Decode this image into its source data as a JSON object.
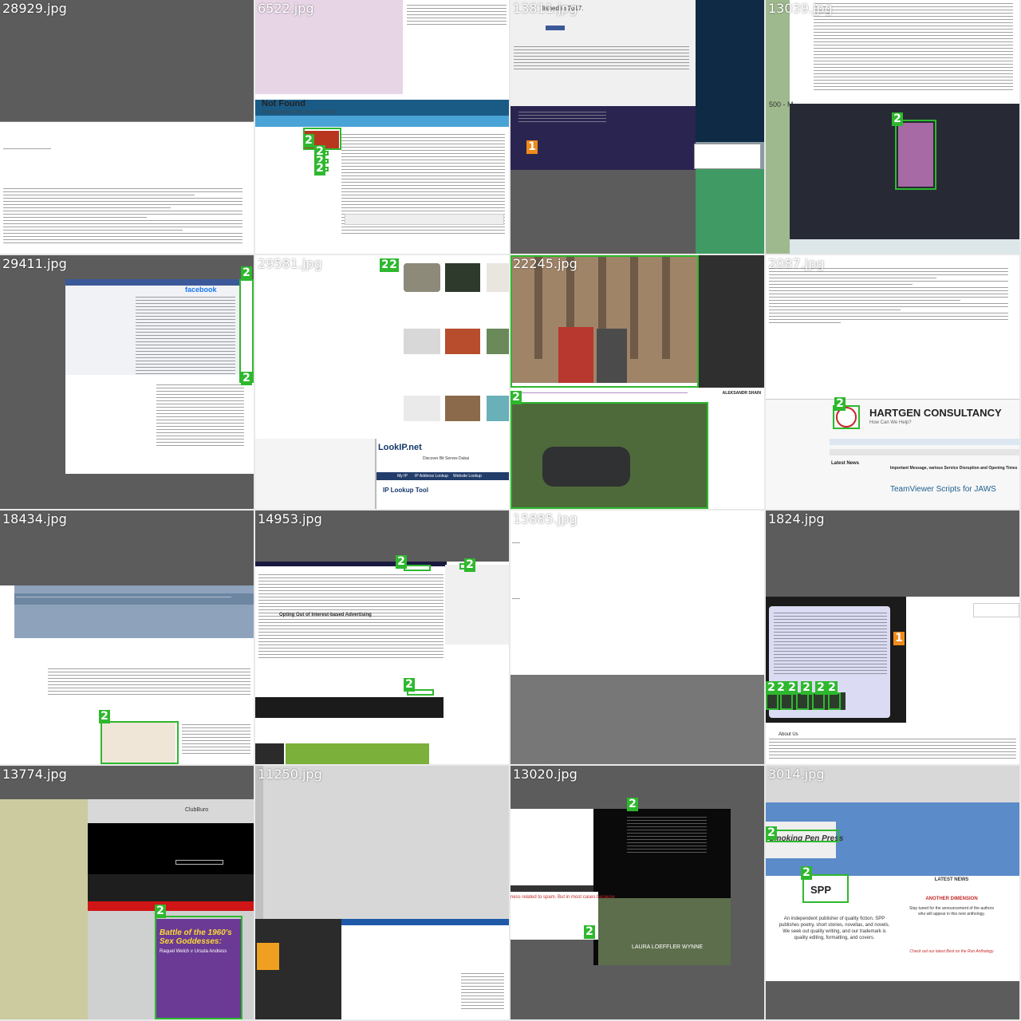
{
  "tiles": [
    {
      "filename": "28929.jpg"
    },
    {
      "filename": "6522.jpg",
      "heading": "Not Found",
      "sub": "The requested URL was not found"
    },
    {
      "filename": "13811.jpg",
      "heading": "lished in 2017."
    },
    {
      "filename": "13039.jpg",
      "side": "500 - M"
    },
    {
      "filename": "29411.jpg",
      "brand": "facebook"
    },
    {
      "filename": "29581.jpg",
      "site": "LookIP.net",
      "nav": [
        "My IP",
        "IP Address Lookup",
        "Website Lookup"
      ],
      "heading": "IP Lookup Tool",
      "ad": "Discover Bit Serves Dubai"
    },
    {
      "filename": "22245.jpg",
      "caption": "ALEKSANDR SHAIN"
    },
    {
      "filename": "2087.jpg",
      "company": "HARTGEN CONSULTANCY",
      "tagline": "How Can We Help?",
      "latest": "Latest News",
      "headline": "TeamViewer Scripts for JAWS",
      "article": "Important Message, various Service Disruption and Opening Times"
    },
    {
      "filename": "18434.jpg"
    },
    {
      "filename": "14953.jpg",
      "heading": "Opting Out of Interest-based Advertising"
    },
    {
      "filename": "15885.jpg"
    },
    {
      "filename": "1824.jpg",
      "side_title": "About Us"
    },
    {
      "filename": "13774.jpg",
      "brand": "ClubBuro",
      "book_title": "Battle of the 1960's Sex Goddesses:",
      "book_sub": "Raquel Welch v Ursula Andress"
    },
    {
      "filename": "11250.jpg"
    },
    {
      "filename": "13020.jpg",
      "red_text": "ness related to spam. But in most cases because",
      "overlay": "LAURA LOEFFLER WYNNE"
    },
    {
      "filename": "3014.jpg",
      "logo": "Smoking Pen Press",
      "logo_short": "SPP",
      "blurb": "An independent publisher of quality fiction. SPP publishes poetry, short stories, novellas, and novels. We seek out quality writing, and our trademark is quality editing, formatting, and covers.",
      "news_title": "LATEST NEWS",
      "news_link": "ANOTHER DIMENSION",
      "news_line": "Stay tuned for the announcement of the authors who will appear in this next anthology.",
      "news_more": "Check out our latest Best on the Run Anthology"
    }
  ],
  "badges": {
    "green": "2",
    "orange": "1"
  },
  "colors": {
    "box": "#2eb82e",
    "orange_badge": "#f08a1c",
    "grey_bg": "#7a7a7a",
    "dark_bg": "#5c5c5c"
  }
}
